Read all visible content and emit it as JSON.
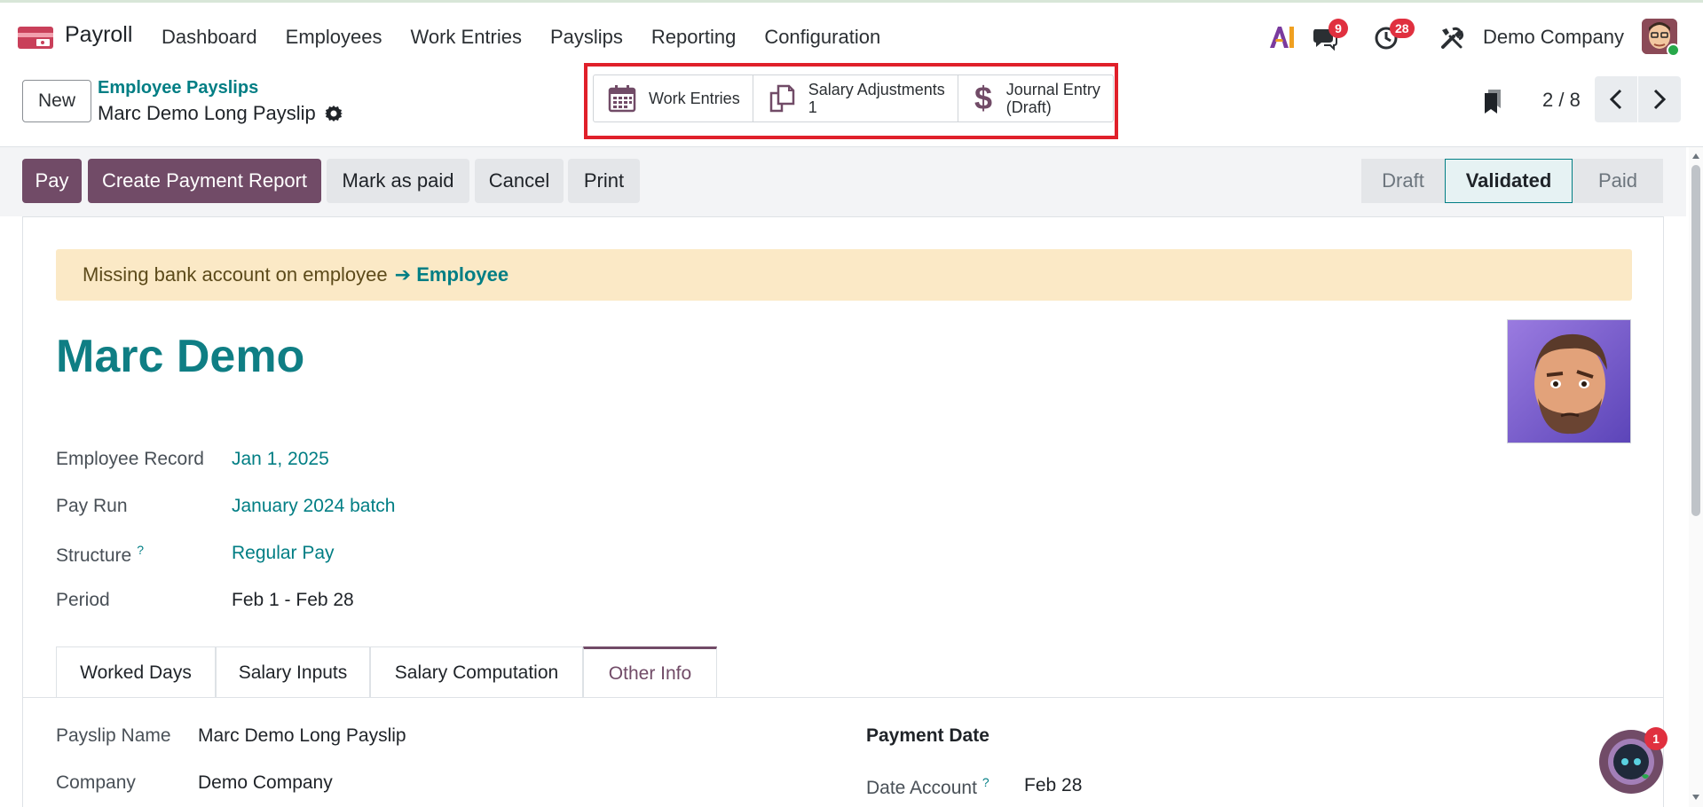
{
  "navbar": {
    "app_name": "Payroll",
    "menu": [
      "Dashboard",
      "Employees",
      "Work Entries",
      "Payslips",
      "Reporting",
      "Configuration"
    ],
    "chat_count": "9",
    "activity_count": "28",
    "company": "Demo Company"
  },
  "control": {
    "new_label": "New",
    "breadcrumb": "Employee Payslips",
    "record_title": "Marc Demo Long Payslip",
    "smart_buttons": {
      "work_entries": "Work Entries",
      "salary_adjustments": "Salary Adjustments",
      "salary_adjustments_count": "1",
      "journal_entry": "Journal Entry",
      "journal_entry_state": "(Draft)"
    },
    "pager": "2 / 8"
  },
  "statusbar": {
    "pay": "Pay",
    "create_report": "Create Payment Report",
    "mark_paid": "Mark as paid",
    "cancel": "Cancel",
    "print": "Print",
    "stages": [
      "Draft",
      "Validated",
      "Paid"
    ],
    "active_stage": "Validated"
  },
  "form": {
    "alert_text": "Missing bank account on employee",
    "alert_link": "➔ Employee",
    "employee_name": "Marc Demo",
    "fields": {
      "employee_record_label": "Employee Record",
      "employee_record_value": "Jan 1, 2025",
      "pay_run_label": "Pay Run",
      "pay_run_value": "January 2024 batch",
      "structure_label": "Structure",
      "structure_help": "?",
      "structure_value": "Regular Pay",
      "period_label": "Period",
      "period_value": "Feb 1 - Feb 28"
    },
    "tabs": [
      "Worked Days",
      "Salary Inputs",
      "Salary Computation",
      "Other Info"
    ],
    "active_tab": "Other Info",
    "other_info": {
      "payslip_name_label": "Payslip Name",
      "payslip_name_value": "Marc Demo Long Payslip",
      "company_label": "Company",
      "company_value": "Demo Company",
      "payment_date_label": "Payment Date",
      "date_account_label": "Date Account",
      "date_account_help": "?",
      "date_account_value": "Feb 28"
    }
  },
  "chat_widget_count": "1",
  "colors": {
    "primary": "#714b67",
    "link": "#017e84",
    "alert_bg": "#fbe9c6",
    "highlight_box": "#e0202a",
    "badge": "#e0303f"
  }
}
